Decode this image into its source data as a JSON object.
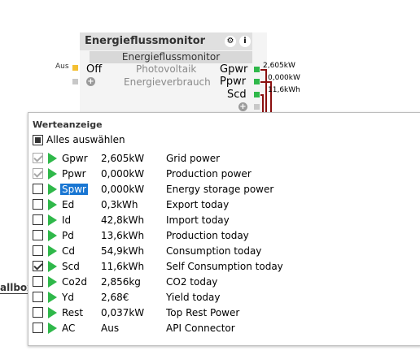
{
  "node": {
    "title": "Energieflussmonitor",
    "subtitle": "Energieflussmonitor",
    "settings_icon": "gear-icon",
    "info_icon": "info-icon",
    "left_inputs": [
      {
        "side_label": "Aus",
        "value": "Off",
        "name": "Photovoltaik"
      },
      {
        "side_label": "",
        "value": "",
        "name": "Energieverbrauch"
      }
    ],
    "outputs": [
      "Gpwr",
      "Ppwr",
      "Scd"
    ],
    "wire_values": [
      "2,605kW",
      "0,000kW",
      "11,6kWh"
    ],
    "colors": {
      "port_active": "#2fb84a",
      "wire": "#8b1010"
    }
  },
  "left_fragment": "allbox",
  "popup": {
    "title": "Werteanzeige",
    "select_all_label": "Alles auswählen",
    "rows": [
      {
        "code": "Gpwr",
        "value": "2,605kW",
        "desc": "Grid power",
        "checked": true,
        "disabled": true
      },
      {
        "code": "Ppwr",
        "value": "0,000kW",
        "desc": "Production power",
        "checked": true,
        "disabled": true
      },
      {
        "code": "Spwr",
        "value": "0,000kW",
        "desc": "Energy storage power",
        "checked": false,
        "disabled": false,
        "selected": true
      },
      {
        "code": "Ed",
        "value": "0,3kWh",
        "desc": "Export today",
        "checked": false,
        "disabled": false
      },
      {
        "code": "Id",
        "value": "42,8kWh",
        "desc": "Import today",
        "checked": false,
        "disabled": false
      },
      {
        "code": "Pd",
        "value": "13,6kWh",
        "desc": "Production today",
        "checked": false,
        "disabled": false
      },
      {
        "code": "Cd",
        "value": "54,9kWh",
        "desc": "Consumption today",
        "checked": false,
        "disabled": false
      },
      {
        "code": "Scd",
        "value": "11,6kWh",
        "desc": "Self Consumption today",
        "checked": true,
        "disabled": false
      },
      {
        "code": "Co2d",
        "value": "2,856kg",
        "desc": "CO2 today",
        "checked": false,
        "disabled": false
      },
      {
        "code": "Yd",
        "value": "2,68€",
        "desc": "Yield today",
        "checked": false,
        "disabled": false
      },
      {
        "code": "Rest",
        "value": "0,037kW",
        "desc": "Top Rest Power",
        "checked": false,
        "disabled": false
      },
      {
        "code": "AC",
        "value": "Aus",
        "desc": "API Connector",
        "checked": false,
        "disabled": false
      }
    ]
  }
}
